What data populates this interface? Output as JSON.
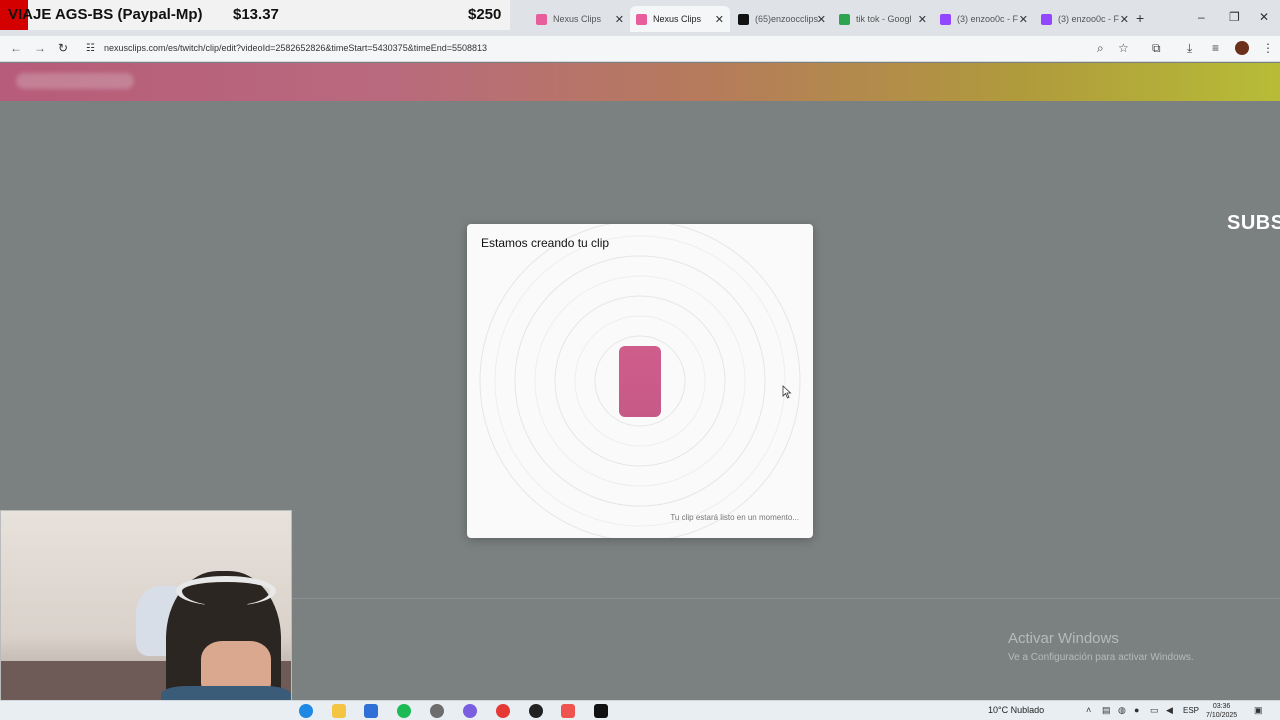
{
  "overlay": {
    "goal_title": "VIAJE AGS-BS (Paypal-Mp)",
    "goal_current": "$13.37",
    "goal_target": "$250"
  },
  "browser": {
    "tabs": [
      {
        "label": "Nexus Clips",
        "favicon": "nexus-icon",
        "active": false
      },
      {
        "label": "Nexus Clips",
        "favicon": "nexus-icon",
        "active": true
      },
      {
        "label": "(65)enzoocclips",
        "favicon": "tiktok-icon",
        "active": false
      },
      {
        "label": "tik tok - Googl",
        "favicon": "google-drive-icon",
        "active": false
      },
      {
        "label": "(3) enzoo0c - F",
        "favicon": "twitch-icon",
        "active": false
      },
      {
        "label": "(3) enzoo0c - F",
        "favicon": "twitch-icon",
        "active": false
      }
    ],
    "url": "nexusclips.com/es/twitch/clip/edit?videoId=2582652826&timeStart=5430375&timeEnd=5508813"
  },
  "page": {
    "side_text": "SUBS"
  },
  "modal": {
    "title": "Estamos creando tu clip",
    "footer": "Tu clip estará listo en un momento..."
  },
  "watermark": {
    "title": "Activar Windows",
    "subtitle": "Ve a Configuración para activar Windows."
  },
  "taskbar": {
    "weather": "10°C  Nublado",
    "language": "ESP",
    "time": "03:36",
    "date": "7/10/2025"
  },
  "colors": {
    "accent": "#cf5d8c",
    "overlay_red": "#d40000"
  }
}
